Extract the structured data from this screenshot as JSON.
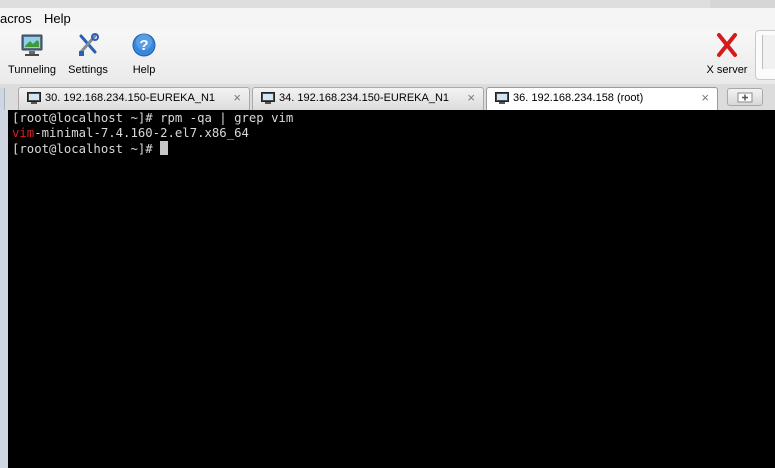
{
  "menu": {
    "macros_label": "acros",
    "help_label": "Help"
  },
  "toolbar": {
    "tunneling_label": "Tunneling",
    "settings_label": "Settings",
    "help_label": "Help",
    "xserver_label": "X server"
  },
  "tabs": [
    {
      "label": "30. 192.168.234.150-EUREKA_N1",
      "active": false
    },
    {
      "label": "34. 192.168.234.150-EUREKA_N1",
      "active": false
    },
    {
      "label": "36. 192.168.234.158 (root)",
      "active": true
    }
  ],
  "terminal": {
    "line1": "[root@localhost ~]# rpm -qa | grep vim",
    "line2_match": "vim",
    "line2_rest": "-minimal-7.4.160-2.el7.x86_64",
    "line3": "[root@localhost ~]# "
  },
  "colors": {
    "terminal_bg": "#000000",
    "terminal_fg": "#d9d9d9",
    "grep_match": "#d81e1e",
    "xserver_red": "#d41a1a"
  }
}
